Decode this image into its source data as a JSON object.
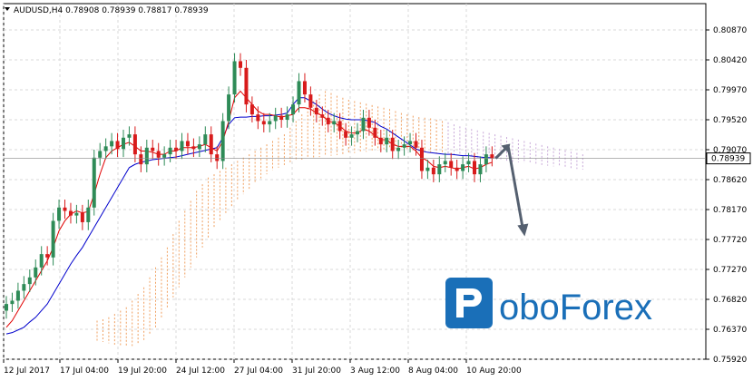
{
  "header": {
    "symbol": "AUDUSD,H4",
    "ohlc": "0.78908 0.78939 0.78817 0.78939"
  },
  "logo": {
    "brand": "RoboForex",
    "color": "#1a6fb8"
  },
  "colors": {
    "bull": "#2e8b57",
    "bear": "#d81b1b",
    "tenkan": "#e00000",
    "kijun": "#0000cc",
    "cloud_orange": "#f0a060",
    "cloud_lilac": "#c8a8d8",
    "arrow": "#556070",
    "grid": "#d8d8d8"
  },
  "chart_data": {
    "type": "candlestick",
    "y_ticks": [
      "0.80870",
      "0.80420",
      "0.79970",
      "0.79520",
      "0.79070",
      "0.78620",
      "0.78170",
      "0.77720",
      "0.77270",
      "0.76820",
      "0.76370",
      "0.75920"
    ],
    "x_ticks": [
      "12 Jul 2017",
      "17 Jul 04:00",
      "19 Jul 20:00",
      "24 Jul 12:00",
      "27 Jul 04:00",
      "31 Jul 20:00",
      "3 Aug 12:00",
      "8 Aug 04:00",
      "10 Aug 20:00"
    ],
    "ylim": [
      0.7592,
      0.8087
    ],
    "current_price": "0.78939",
    "grid": true,
    "closes": [
      0.7675,
      0.768,
      0.7695,
      0.7705,
      0.7715,
      0.773,
      0.775,
      0.7745,
      0.78,
      0.782,
      0.7815,
      0.7808,
      0.7812,
      0.7798,
      0.782,
      0.7895,
      0.7905,
      0.7912,
      0.792,
      0.7908,
      0.7925,
      0.793,
      0.79,
      0.7885,
      0.791,
      0.7905,
      0.7895,
      0.79,
      0.791,
      0.7905,
      0.792,
      0.7912,
      0.7908,
      0.7915,
      0.793,
      0.79,
      0.789,
      0.795,
      0.799,
      0.804,
      0.803,
      0.7975,
      0.796,
      0.795,
      0.7945,
      0.795,
      0.7958,
      0.7952,
      0.796,
      0.7975,
      0.801,
      0.799,
      0.797,
      0.796,
      0.7955,
      0.7945,
      0.795,
      0.7935,
      0.7925,
      0.793,
      0.7935,
      0.7955,
      0.794,
      0.7925,
      0.7915,
      0.7925,
      0.7905,
      0.791,
      0.7915,
      0.792,
      0.791,
      0.7875,
      0.788,
      0.787,
      0.7885,
      0.789,
      0.788,
      0.7875,
      0.7885,
      0.789,
      0.787,
      0.7885,
      0.79,
      0.7894
    ],
    "tenkan": [
      0.764,
      0.765,
      0.7665,
      0.768,
      0.7695,
      0.771,
      0.7725,
      0.774,
      0.776,
      0.7785,
      0.78,
      0.781,
      0.7815,
      0.7812,
      0.7814,
      0.784,
      0.787,
      0.7895,
      0.7905,
      0.791,
      0.7915,
      0.7918,
      0.7912,
      0.7905,
      0.7905,
      0.7903,
      0.79,
      0.79,
      0.7905,
      0.7905,
      0.791,
      0.791,
      0.791,
      0.7912,
      0.7915,
      0.791,
      0.7905,
      0.792,
      0.795,
      0.7985,
      0.7995,
      0.7985,
      0.7975,
      0.7965,
      0.796,
      0.796,
      0.7958,
      0.7956,
      0.7958,
      0.796,
      0.797,
      0.797,
      0.7968,
      0.7962,
      0.7958,
      0.795,
      0.7948,
      0.7942,
      0.7935,
      0.7932,
      0.7932,
      0.7938,
      0.7935,
      0.7928,
      0.7922,
      0.7922,
      0.7915,
      0.7912,
      0.7912,
      0.7912,
      0.7905,
      0.7895,
      0.789,
      0.7882,
      0.788,
      0.7882,
      0.788,
      0.7878,
      0.788,
      0.7882,
      0.7878,
      0.788,
      0.7885,
      0.7888
    ],
    "kijun": [
      0.763,
      0.7632,
      0.7636,
      0.764,
      0.7648,
      0.7655,
      0.7665,
      0.7675,
      0.769,
      0.7705,
      0.772,
      0.7735,
      0.7748,
      0.776,
      0.7775,
      0.779,
      0.7805,
      0.782,
      0.7835,
      0.785,
      0.7865,
      0.788,
      0.7885,
      0.7888,
      0.789,
      0.7892,
      0.7893,
      0.7894,
      0.7895,
      0.7896,
      0.7898,
      0.79,
      0.7902,
      0.7904,
      0.7906,
      0.7908,
      0.791,
      0.7925,
      0.7945,
      0.7955,
      0.7956,
      0.7956,
      0.7957,
      0.7957,
      0.7958,
      0.7958,
      0.7959,
      0.796,
      0.7962,
      0.7975,
      0.7985,
      0.7985,
      0.798,
      0.7975,
      0.7968,
      0.7962,
      0.7958,
      0.7955,
      0.7953,
      0.7952,
      0.7952,
      0.7952,
      0.795,
      0.7948,
      0.7942,
      0.7938,
      0.7932,
      0.7926,
      0.792,
      0.7914,
      0.7908,
      0.7905,
      0.7903,
      0.7902,
      0.7901,
      0.79,
      0.79,
      0.7899,
      0.7898,
      0.7898,
      0.7897,
      0.7896,
      0.7895,
      0.7895
    ],
    "cloud": {
      "x_from": 0,
      "top": [
        0.765,
        0.7652,
        0.7655,
        0.766,
        0.7665,
        0.767,
        0.768,
        0.769,
        0.77,
        0.7715,
        0.773,
        0.7745,
        0.776,
        0.778,
        0.78,
        0.7815,
        0.783,
        0.7845,
        0.7855,
        0.7865,
        0.787,
        0.7875,
        0.788,
        0.7885,
        0.789,
        0.7895,
        0.79,
        0.7905,
        0.791,
        0.7915,
        0.792,
        0.7925,
        0.793,
        0.794,
        0.795,
        0.796,
        0.797,
        0.798,
        0.799,
        0.7995,
        0.7992,
        0.7988,
        0.7985,
        0.7982,
        0.798,
        0.7978,
        0.7976,
        0.7974,
        0.7972,
        0.797,
        0.7968,
        0.7965,
        0.7962,
        0.796,
        0.7958,
        0.7956,
        0.7955,
        0.7954,
        0.7952,
        0.795,
        0.7948,
        0.7945,
        0.7942,
        0.794,
        0.7938,
        0.7936,
        0.7934,
        0.7932,
        0.793,
        0.7928,
        0.7926,
        0.7924,
        0.7922,
        0.792,
        0.7918,
        0.7916,
        0.7914,
        0.7912,
        0.791,
        0.7908,
        0.7906,
        0.7904,
        0.7902,
        0.79
      ],
      "bottom": [
        0.762,
        0.7618,
        0.7616,
        0.7614,
        0.7612,
        0.761,
        0.7612,
        0.7615,
        0.762,
        0.763,
        0.764,
        0.7655,
        0.767,
        0.7685,
        0.77,
        0.7715,
        0.773,
        0.7745,
        0.776,
        0.7775,
        0.779,
        0.78,
        0.781,
        0.782,
        0.783,
        0.784,
        0.7848,
        0.7856,
        0.7864,
        0.787,
        0.7876,
        0.788,
        0.7884,
        0.7888,
        0.789,
        0.7892,
        0.7894,
        0.7895,
        0.7896,
        0.7897,
        0.7898,
        0.7899,
        0.79,
        0.7901,
        0.7902,
        0.7903,
        0.7904,
        0.7905,
        0.7906,
        0.7907,
        0.7908,
        0.7908,
        0.7908,
        0.7907,
        0.7906,
        0.7905,
        0.7904,
        0.7903,
        0.7902,
        0.7901,
        0.79,
        0.7899,
        0.7898,
        0.7897,
        0.7896,
        0.7895,
        0.7894,
        0.7893,
        0.7892,
        0.7891,
        0.789,
        0.7889,
        0.7888,
        0.7887,
        0.7886,
        0.7885,
        0.7884,
        0.7883,
        0.7882,
        0.7881,
        0.788,
        0.7879,
        0.7878,
        0.7877
      ]
    }
  }
}
